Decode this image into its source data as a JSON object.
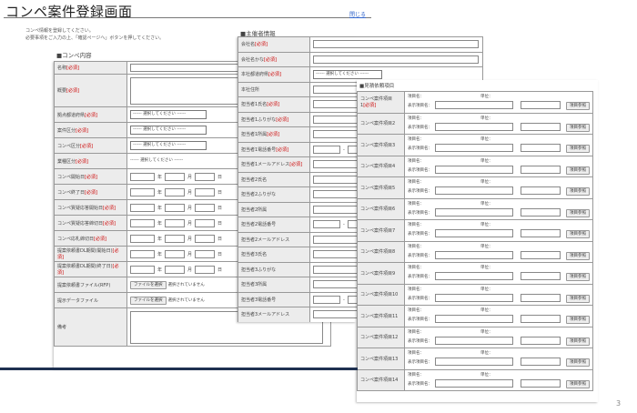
{
  "page": {
    "title": "コンペ案件登録画面",
    "close_link": "閉じる",
    "intro_line1": "コンペ情報を登録してください。",
    "intro_line2": "必要事項をご入力の上、「確認ページへ」ボタンを押してください。",
    "page_number": "3"
  },
  "common": {
    "required": "[必須]",
    "select_placeholder": "------ 選択してください ------",
    "year": "年",
    "month": "月",
    "day": "日",
    "file_button": "ファイルを選択",
    "no_file": "選択されていません",
    "item_name": "項目名：",
    "display_item_name": "表示項目名：",
    "unit": "単位：",
    "ref_button": "項目参照",
    "dash": "-"
  },
  "competition": {
    "heading": "■コンペ内容",
    "fields": [
      {
        "label": "名称",
        "required": true
      },
      {
        "label": "概要",
        "required": true
      },
      {
        "label": "拠点都道府県",
        "required": true
      },
      {
        "label": "案件区分",
        "required": true
      },
      {
        "label": "コンペ区分",
        "required": true
      },
      {
        "label": "業種区分",
        "required": true
      },
      {
        "label": "コンペ開始日",
        "required": true
      },
      {
        "label": "コンペ終了日",
        "required": true
      },
      {
        "label": "コンペ質疑応答開始日",
        "required": true
      },
      {
        "label": "コンペ質疑応答締切日",
        "required": true
      },
      {
        "label": "コンペ応札締切日",
        "required": true
      },
      {
        "label": "提案依頼書DL期間(開始日)",
        "required": true
      },
      {
        "label": "提案依頼書DL期間(終了日)",
        "required": true
      },
      {
        "label": "提案依頼書ファイル(RFP)",
        "required": false
      },
      {
        "label": "提示データファイル",
        "required": false
      },
      {
        "label": "備考",
        "required": false
      }
    ]
  },
  "organizer": {
    "heading": "■主催者情報",
    "fields": [
      {
        "label": "会社名",
        "required": true
      },
      {
        "label": "会社名かな",
        "required": true
      },
      {
        "label": "本社都道府県",
        "required": true
      },
      {
        "label": "本社住所",
        "required": false
      },
      {
        "label": "担当者1氏名",
        "required": true
      },
      {
        "label": "担当者1ふりがな",
        "required": true
      },
      {
        "label": "担当者1所属",
        "required": true
      },
      {
        "label": "担当者1電話番号",
        "required": true
      },
      {
        "label": "担当者1メールアドレス",
        "required": true
      },
      {
        "label": "担当者2氏名",
        "required": false
      },
      {
        "label": "担当者2ふりがな",
        "required": false
      },
      {
        "label": "担当者2所属",
        "required": false
      },
      {
        "label": "担当者2電話番号",
        "required": false
      },
      {
        "label": "担当者2メールアドレス",
        "required": false
      },
      {
        "label": "担当者3氏名",
        "required": false
      },
      {
        "label": "担当者3ふりがな",
        "required": false
      },
      {
        "label": "担当者3所属",
        "required": false
      },
      {
        "label": "担当者3電話番号",
        "required": false
      },
      {
        "label": "担当者3メールアドレス",
        "required": false
      }
    ]
  },
  "estimate": {
    "heading": "■見積依頼項目",
    "items": [
      {
        "label": "コンペ案件項目1",
        "required": true
      },
      {
        "label": "コンペ案件項目2",
        "required": false
      },
      {
        "label": "コンペ案件項目3",
        "required": false
      },
      {
        "label": "コンペ案件項目4",
        "required": false
      },
      {
        "label": "コンペ案件項目5",
        "required": false
      },
      {
        "label": "コンペ案件項目6",
        "required": false
      },
      {
        "label": "コンペ案件項目7",
        "required": false
      },
      {
        "label": "コンペ案件項目8",
        "required": false
      },
      {
        "label": "コンペ案件項目9",
        "required": false
      },
      {
        "label": "コンペ案件項目10",
        "required": false
      },
      {
        "label": "コンペ案件項目11",
        "required": false
      },
      {
        "label": "コンペ案件項目12",
        "required": false
      },
      {
        "label": "コンペ案件項目13",
        "required": false
      },
      {
        "label": "コンペ案件項目14",
        "required": false
      }
    ]
  }
}
